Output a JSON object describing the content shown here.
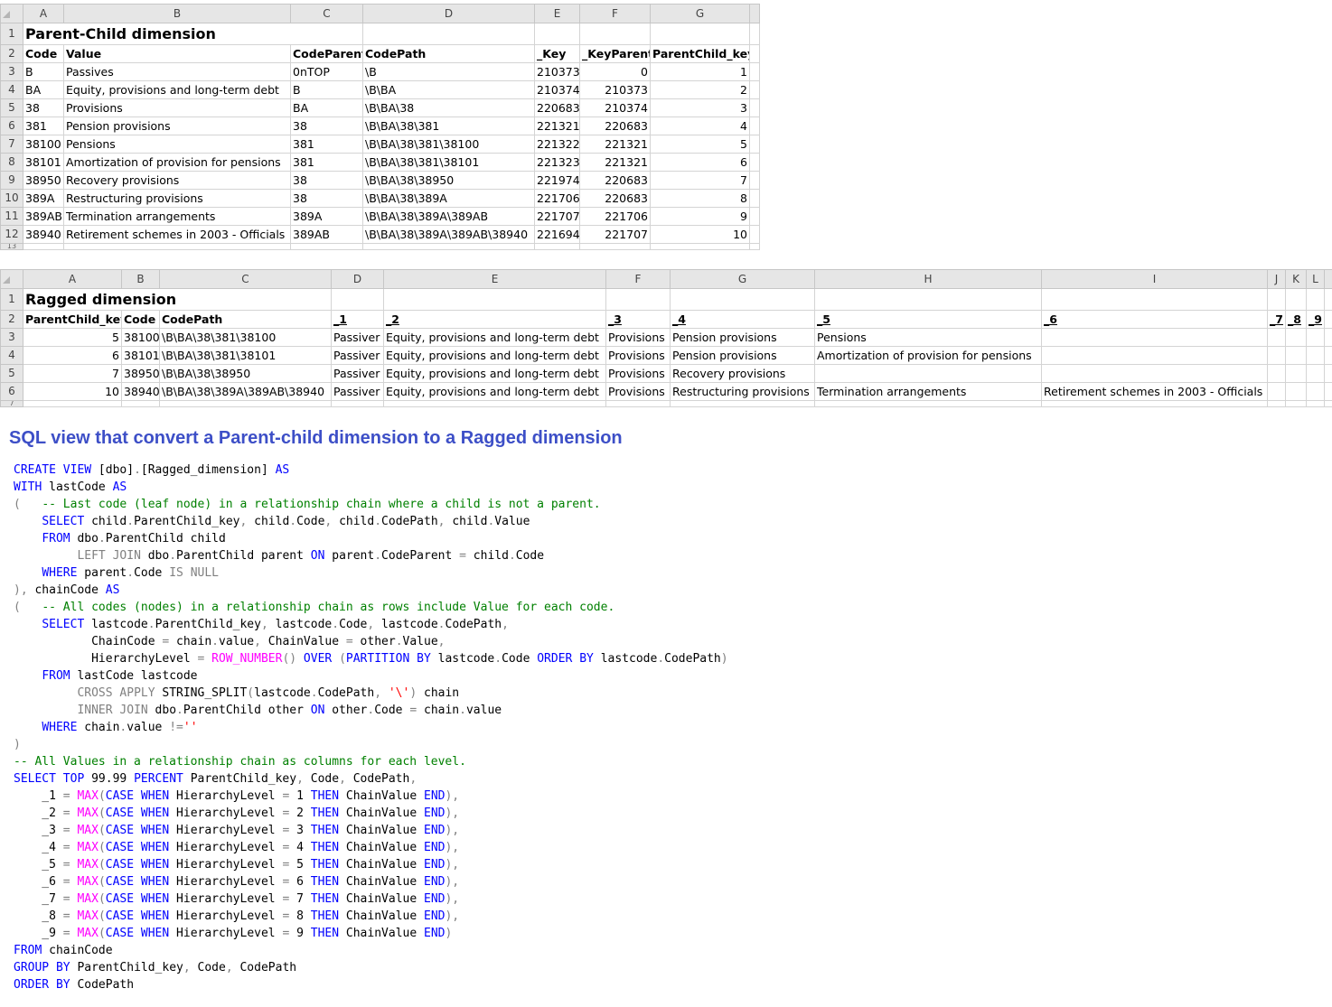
{
  "sheet1": {
    "columns": [
      "A",
      "B",
      "C",
      "D",
      "E",
      "F",
      "G"
    ],
    "rows": [
      "1",
      "2",
      "3",
      "4",
      "5",
      "6",
      "7",
      "8",
      "9",
      "10",
      "11",
      "12",
      "13"
    ],
    "title": "Parent-Child dimension",
    "headers": [
      "Code",
      "Value",
      "CodeParent",
      "CodePath",
      "_Key",
      "_KeyParent",
      "ParentChild_key"
    ],
    "data": [
      [
        "B",
        "Passives",
        "0nTOP",
        "\\B",
        "210373",
        "0",
        "1"
      ],
      [
        "BA",
        "Equity, provisions and long-term debt",
        "B",
        "\\B\\BA",
        "210374",
        "210373",
        "2"
      ],
      [
        "38",
        "Provisions",
        "BA",
        "\\B\\BA\\38",
        "220683",
        "210374",
        "3"
      ],
      [
        "381",
        "Pension provisions",
        "38",
        "\\B\\BA\\38\\381",
        "221321",
        "220683",
        "4"
      ],
      [
        "38100",
        "Pensions",
        "381",
        "\\B\\BA\\38\\381\\38100",
        "221322",
        "221321",
        "5"
      ],
      [
        "38101",
        "Amortization of provision for pensions",
        "381",
        "\\B\\BA\\38\\381\\38101",
        "221323",
        "221321",
        "6"
      ],
      [
        "38950",
        "Recovery provisions",
        "38",
        "\\B\\BA\\38\\38950",
        "221974",
        "220683",
        "7"
      ],
      [
        "389A",
        "Restructuring provisions",
        "38",
        "\\B\\BA\\38\\389A",
        "221706",
        "220683",
        "8"
      ],
      [
        "389AB",
        "Termination arrangements",
        "389A",
        "\\B\\BA\\38\\389A\\389AB",
        "221707",
        "221706",
        "9"
      ],
      [
        "38940",
        "Retirement schemes in 2003 - Officials",
        "389AB",
        "\\B\\BA\\38\\389A\\389AB\\38940",
        "221694",
        "221707",
        "10"
      ]
    ]
  },
  "sheet2": {
    "columns": [
      "A",
      "B",
      "C",
      "D",
      "E",
      "F",
      "G",
      "H",
      "I",
      "J",
      "K",
      "L"
    ],
    "rows": [
      "1",
      "2",
      "3",
      "4",
      "5",
      "6",
      "7"
    ],
    "title": "Ragged dimension",
    "headers": [
      "ParentChild_key",
      "Code",
      "CodePath",
      "_1",
      "_2",
      "_3",
      "_4",
      "_5",
      "_6",
      "_7",
      "_8",
      "_9"
    ],
    "data": [
      [
        "5",
        "38100",
        "\\B\\BA\\38\\381\\38100",
        "Passiver",
        "Equity, provisions and long-term debt",
        "Provisions",
        "Pension provisions",
        "Pensions",
        "",
        "",
        "",
        ""
      ],
      [
        "6",
        "38101",
        "\\B\\BA\\38\\381\\38101",
        "Passiver",
        "Equity, provisions and long-term debt",
        "Provisions",
        "Pension provisions",
        "Amortization of provision for pensions",
        "",
        "",
        "",
        ""
      ],
      [
        "7",
        "38950",
        "\\B\\BA\\38\\38950",
        "Passiver",
        "Equity, provisions and long-term debt",
        "Provisions",
        "Recovery provisions",
        "",
        "",
        "",
        "",
        ""
      ],
      [
        "10",
        "38940",
        "\\B\\BA\\38\\389A\\389AB\\38940",
        "Passiver",
        "Equity, provisions and long-term debt",
        "Provisions",
        "Restructuring provisions",
        "Termination arrangements",
        "Retirement schemes in 2003 - Officials",
        "",
        "",
        ""
      ]
    ]
  },
  "heading": "SQL view that convert a Parent-child dimension to a Ragged dimension",
  "sql": [
    [
      [
        "kw",
        "CREATE VIEW "
      ],
      [
        "",
        "[dbo]"
      ],
      [
        "gr",
        "."
      ],
      [
        "",
        "[Ragged_dimension] "
      ],
      [
        "kw",
        "AS"
      ]
    ],
    [
      [
        "kw",
        "WITH "
      ],
      [
        "",
        "lastCode "
      ],
      [
        "kw",
        "AS"
      ]
    ],
    [
      [
        "gr",
        "(   "
      ],
      [
        "cm",
        "-- Last code (leaf node) in a relationship chain where a child is not a parent."
      ]
    ],
    [
      [
        "",
        "    "
      ],
      [
        "kw",
        "SELECT "
      ],
      [
        "",
        "child"
      ],
      [
        "gr",
        "."
      ],
      [
        "",
        "ParentChild_key"
      ],
      [
        "gr",
        ", "
      ],
      [
        "",
        "child"
      ],
      [
        "gr",
        "."
      ],
      [
        "",
        "Code"
      ],
      [
        "gr",
        ", "
      ],
      [
        "",
        "child"
      ],
      [
        "gr",
        "."
      ],
      [
        "",
        "CodePath"
      ],
      [
        "gr",
        ", "
      ],
      [
        "",
        "child"
      ],
      [
        "gr",
        "."
      ],
      [
        "",
        "Value"
      ]
    ],
    [
      [
        "",
        "    "
      ],
      [
        "kw",
        "FROM "
      ],
      [
        "",
        "dbo"
      ],
      [
        "gr",
        "."
      ],
      [
        "",
        "ParentChild child"
      ]
    ],
    [
      [
        "",
        "         "
      ],
      [
        "gr",
        "LEFT JOIN "
      ],
      [
        "",
        "dbo"
      ],
      [
        "gr",
        "."
      ],
      [
        "",
        "ParentChild parent "
      ],
      [
        "kw",
        "ON "
      ],
      [
        "",
        "parent"
      ],
      [
        "gr",
        "."
      ],
      [
        "",
        "CodeParent "
      ],
      [
        "gr",
        "= "
      ],
      [
        "",
        "child"
      ],
      [
        "gr",
        "."
      ],
      [
        "",
        "Code"
      ]
    ],
    [
      [
        "",
        "    "
      ],
      [
        "kw",
        "WHERE "
      ],
      [
        "",
        "parent"
      ],
      [
        "gr",
        "."
      ],
      [
        "",
        "Code "
      ],
      [
        "gr",
        "IS NULL"
      ]
    ],
    [
      [
        "gr",
        "), "
      ],
      [
        "",
        "chainCode "
      ],
      [
        "kw",
        "AS"
      ]
    ],
    [
      [
        "gr",
        "(   "
      ],
      [
        "cm",
        "-- All codes (nodes) in a relationship chain as rows include Value for each code."
      ]
    ],
    [
      [
        "",
        "    "
      ],
      [
        "kw",
        "SELECT "
      ],
      [
        "",
        "lastcode"
      ],
      [
        "gr",
        "."
      ],
      [
        "",
        "ParentChild_key"
      ],
      [
        "gr",
        ", "
      ],
      [
        "",
        "lastcode"
      ],
      [
        "gr",
        "."
      ],
      [
        "",
        "Code"
      ],
      [
        "gr",
        ", "
      ],
      [
        "",
        "lastcode"
      ],
      [
        "gr",
        "."
      ],
      [
        "",
        "CodePath"
      ],
      [
        "gr",
        ","
      ]
    ],
    [
      [
        "",
        "           "
      ],
      [
        "",
        "ChainCode "
      ],
      [
        "gr",
        "= "
      ],
      [
        "",
        "chain"
      ],
      [
        "gr",
        "."
      ],
      [
        "",
        "value"
      ],
      [
        "gr",
        ", "
      ],
      [
        "",
        "ChainValue "
      ],
      [
        "gr",
        "= "
      ],
      [
        "",
        "other"
      ],
      [
        "gr",
        "."
      ],
      [
        "",
        "Value"
      ],
      [
        "gr",
        ","
      ]
    ],
    [
      [
        "",
        "           "
      ],
      [
        "",
        "HierarchyLevel "
      ],
      [
        "gr",
        "= "
      ],
      [
        "fn",
        "ROW_NUMBER"
      ],
      [
        "gr",
        "() "
      ],
      [
        "kw",
        "OVER "
      ],
      [
        "gr",
        "("
      ],
      [
        "kw",
        "PARTITION BY "
      ],
      [
        "",
        "lastcode"
      ],
      [
        "gr",
        "."
      ],
      [
        "",
        "Code "
      ],
      [
        "kw",
        "ORDER BY "
      ],
      [
        "",
        "lastcode"
      ],
      [
        "gr",
        "."
      ],
      [
        "",
        "CodePath"
      ],
      [
        "gr",
        ")"
      ]
    ],
    [
      [
        "",
        "    "
      ],
      [
        "kw",
        "FROM "
      ],
      [
        "",
        "lastCode lastcode"
      ]
    ],
    [
      [
        "",
        "         "
      ],
      [
        "gr",
        "CROSS APPLY "
      ],
      [
        "",
        "STRING_SPLIT"
      ],
      [
        "gr",
        "("
      ],
      [
        "",
        "lastcode"
      ],
      [
        "gr",
        "."
      ],
      [
        "",
        "CodePath"
      ],
      [
        "gr",
        ", "
      ],
      [
        "st",
        "'\\'"
      ],
      [
        "gr",
        ") "
      ],
      [
        "",
        "chain"
      ]
    ],
    [
      [
        "",
        "         "
      ],
      [
        "gr",
        "INNER JOIN "
      ],
      [
        "",
        "dbo"
      ],
      [
        "gr",
        "."
      ],
      [
        "",
        "ParentChild other "
      ],
      [
        "kw",
        "ON "
      ],
      [
        "",
        "other"
      ],
      [
        "gr",
        "."
      ],
      [
        "",
        "Code "
      ],
      [
        "gr",
        "= "
      ],
      [
        "",
        "chain"
      ],
      [
        "gr",
        "."
      ],
      [
        "",
        "value"
      ]
    ],
    [
      [
        "",
        "    "
      ],
      [
        "kw",
        "WHERE "
      ],
      [
        "",
        "chain"
      ],
      [
        "gr",
        "."
      ],
      [
        "",
        "value "
      ],
      [
        "gr",
        "!="
      ],
      [
        "st",
        "''"
      ]
    ],
    [
      [
        "gr",
        ")"
      ]
    ],
    [
      [
        "cm",
        "-- All Values in a relationship chain as columns for each level."
      ]
    ],
    [
      [
        "kw",
        "SELECT TOP "
      ],
      [
        "",
        "99.99 "
      ],
      [
        "kw",
        "PERCENT "
      ],
      [
        "",
        "ParentChild_key"
      ],
      [
        "gr",
        ", "
      ],
      [
        "",
        "Code"
      ],
      [
        "gr",
        ", "
      ],
      [
        "",
        "CodePath"
      ],
      [
        "gr",
        ","
      ]
    ],
    [
      [
        "",
        "    _1 "
      ],
      [
        "gr",
        "= "
      ],
      [
        "fn",
        "MAX"
      ],
      [
        "gr",
        "("
      ],
      [
        "kw",
        "CASE WHEN "
      ],
      [
        "",
        "HierarchyLevel "
      ],
      [
        "gr",
        "= "
      ],
      [
        "",
        "1 "
      ],
      [
        "kw",
        "THEN "
      ],
      [
        "",
        "ChainValue "
      ],
      [
        "kw",
        "END"
      ],
      [
        "gr",
        "),"
      ]
    ],
    [
      [
        "",
        "    _2 "
      ],
      [
        "gr",
        "= "
      ],
      [
        "fn",
        "MAX"
      ],
      [
        "gr",
        "("
      ],
      [
        "kw",
        "CASE WHEN "
      ],
      [
        "",
        "HierarchyLevel "
      ],
      [
        "gr",
        "= "
      ],
      [
        "",
        "2 "
      ],
      [
        "kw",
        "THEN "
      ],
      [
        "",
        "ChainValue "
      ],
      [
        "kw",
        "END"
      ],
      [
        "gr",
        "),"
      ]
    ],
    [
      [
        "",
        "    _3 "
      ],
      [
        "gr",
        "= "
      ],
      [
        "fn",
        "MAX"
      ],
      [
        "gr",
        "("
      ],
      [
        "kw",
        "CASE WHEN "
      ],
      [
        "",
        "HierarchyLevel "
      ],
      [
        "gr",
        "= "
      ],
      [
        "",
        "3 "
      ],
      [
        "kw",
        "THEN "
      ],
      [
        "",
        "ChainValue "
      ],
      [
        "kw",
        "END"
      ],
      [
        "gr",
        "),"
      ]
    ],
    [
      [
        "",
        "    _4 "
      ],
      [
        "gr",
        "= "
      ],
      [
        "fn",
        "MAX"
      ],
      [
        "gr",
        "("
      ],
      [
        "kw",
        "CASE WHEN "
      ],
      [
        "",
        "HierarchyLevel "
      ],
      [
        "gr",
        "= "
      ],
      [
        "",
        "4 "
      ],
      [
        "kw",
        "THEN "
      ],
      [
        "",
        "ChainValue "
      ],
      [
        "kw",
        "END"
      ],
      [
        "gr",
        "),"
      ]
    ],
    [
      [
        "",
        "    _5 "
      ],
      [
        "gr",
        "= "
      ],
      [
        "fn",
        "MAX"
      ],
      [
        "gr",
        "("
      ],
      [
        "kw",
        "CASE WHEN "
      ],
      [
        "",
        "HierarchyLevel "
      ],
      [
        "gr",
        "= "
      ],
      [
        "",
        "5 "
      ],
      [
        "kw",
        "THEN "
      ],
      [
        "",
        "ChainValue "
      ],
      [
        "kw",
        "END"
      ],
      [
        "gr",
        "),"
      ]
    ],
    [
      [
        "",
        "    _6 "
      ],
      [
        "gr",
        "= "
      ],
      [
        "fn",
        "MAX"
      ],
      [
        "gr",
        "("
      ],
      [
        "kw",
        "CASE WHEN "
      ],
      [
        "",
        "HierarchyLevel "
      ],
      [
        "gr",
        "= "
      ],
      [
        "",
        "6 "
      ],
      [
        "kw",
        "THEN "
      ],
      [
        "",
        "ChainValue "
      ],
      [
        "kw",
        "END"
      ],
      [
        "gr",
        "),"
      ]
    ],
    [
      [
        "",
        "    _7 "
      ],
      [
        "gr",
        "= "
      ],
      [
        "fn",
        "MAX"
      ],
      [
        "gr",
        "("
      ],
      [
        "kw",
        "CASE WHEN "
      ],
      [
        "",
        "HierarchyLevel "
      ],
      [
        "gr",
        "= "
      ],
      [
        "",
        "7 "
      ],
      [
        "kw",
        "THEN "
      ],
      [
        "",
        "ChainValue "
      ],
      [
        "kw",
        "END"
      ],
      [
        "gr",
        "),"
      ]
    ],
    [
      [
        "",
        "    _8 "
      ],
      [
        "gr",
        "= "
      ],
      [
        "fn",
        "MAX"
      ],
      [
        "gr",
        "("
      ],
      [
        "kw",
        "CASE WHEN "
      ],
      [
        "",
        "HierarchyLevel "
      ],
      [
        "gr",
        "= "
      ],
      [
        "",
        "8 "
      ],
      [
        "kw",
        "THEN "
      ],
      [
        "",
        "ChainValue "
      ],
      [
        "kw",
        "END"
      ],
      [
        "gr",
        "),"
      ]
    ],
    [
      [
        "",
        "    _9 "
      ],
      [
        "gr",
        "= "
      ],
      [
        "fn",
        "MAX"
      ],
      [
        "gr",
        "("
      ],
      [
        "kw",
        "CASE WHEN "
      ],
      [
        "",
        "HierarchyLevel "
      ],
      [
        "gr",
        "= "
      ],
      [
        "",
        "9 "
      ],
      [
        "kw",
        "THEN "
      ],
      [
        "",
        "ChainValue "
      ],
      [
        "kw",
        "END"
      ],
      [
        "gr",
        ")"
      ]
    ],
    [
      [
        "kw",
        "FROM "
      ],
      [
        "",
        "chainCode"
      ]
    ],
    [
      [
        "kw",
        "GROUP BY "
      ],
      [
        "",
        "ParentChild_key"
      ],
      [
        "gr",
        ", "
      ],
      [
        "",
        "Code"
      ],
      [
        "gr",
        ", "
      ],
      [
        "",
        "CodePath"
      ]
    ],
    [
      [
        "kw",
        "ORDER BY "
      ],
      [
        "",
        "CodePath"
      ]
    ]
  ]
}
